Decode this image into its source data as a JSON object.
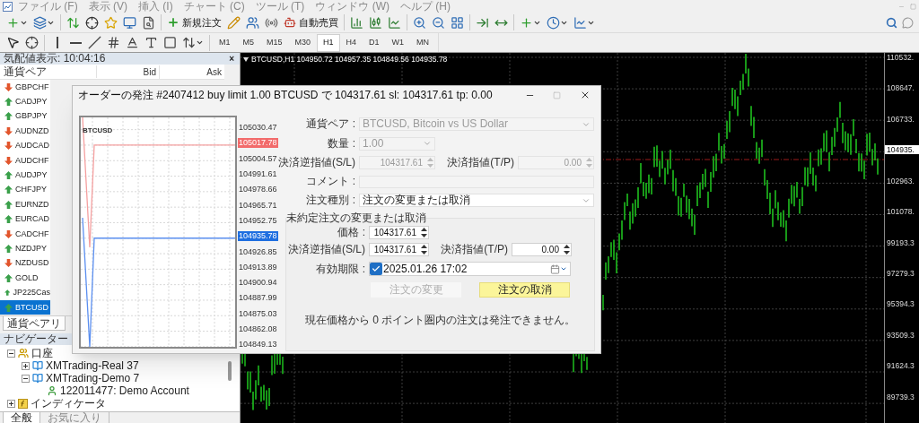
{
  "menu": [
    "ファイル (F)",
    "表示 (V)",
    "挿入 (I)",
    "チャート (C)",
    "ツール (T)",
    "ウィンドウ (W)",
    "ヘルプ (H)"
  ],
  "toolbar": {
    "new_order": "新規注文",
    "auto_trading": "自動売買"
  },
  "timeframes": [
    {
      "label": "M1",
      "selected": false
    },
    {
      "label": "M5",
      "selected": false
    },
    {
      "label": "M15",
      "selected": false
    },
    {
      "label": "M30",
      "selected": false
    },
    {
      "label": "H1",
      "selected": true
    },
    {
      "label": "H4",
      "selected": false
    },
    {
      "label": "D1",
      "selected": false
    },
    {
      "label": "W1",
      "selected": false
    },
    {
      "label": "MN",
      "selected": false
    }
  ],
  "market_watch": {
    "title": "気配値表示: 10:04:16",
    "close": "×",
    "columns": [
      "通貨ペア",
      "Bid",
      "Ask"
    ],
    "rows": [
      {
        "symbol": "GBPCHF",
        "rising": false,
        "selected": false
      },
      {
        "symbol": "CADJPY",
        "rising": true,
        "selected": false
      },
      {
        "symbol": "GBPJPY",
        "rising": true,
        "selected": false
      },
      {
        "symbol": "AUDNZD",
        "rising": false,
        "selected": false
      },
      {
        "symbol": "AUDCAD",
        "rising": false,
        "selected": false
      },
      {
        "symbol": "AUDCHF",
        "rising": false,
        "selected": false
      },
      {
        "symbol": "AUDJPY",
        "rising": true,
        "selected": false
      },
      {
        "symbol": "CHFJPY",
        "rising": true,
        "selected": false
      },
      {
        "symbol": "EURNZD",
        "rising": true,
        "selected": false
      },
      {
        "symbol": "EURCAD",
        "rising": true,
        "selected": false
      },
      {
        "symbol": "CADCHF",
        "rising": false,
        "selected": false
      },
      {
        "symbol": "NZDJPY",
        "rising": true,
        "selected": false
      },
      {
        "symbol": "NZDUSD",
        "rising": false,
        "selected": false
      },
      {
        "symbol": "GOLD",
        "rising": true,
        "selected": false
      },
      {
        "symbol": "JP225Cas",
        "rising": true,
        "selected": false
      },
      {
        "symbol": "BTCUSD",
        "rising": true,
        "selected": true
      }
    ],
    "tab": "通貨ペアリ"
  },
  "navigator": {
    "title": "ナビゲーター",
    "tree": [
      {
        "label": "口座",
        "kind": "accounts",
        "expanded": true,
        "children": [
          {
            "label": "XMTrading-Real 37",
            "kind": "server",
            "expanded": false
          },
          {
            "label": "XMTrading-Demo 7",
            "kind": "server",
            "expanded": true,
            "children": [
              {
                "label": "122011477: Demo Account",
                "kind": "account"
              }
            ]
          }
        ]
      },
      {
        "label": "インディケータ",
        "kind": "indicators",
        "expanded": false
      }
    ],
    "tabs": [
      {
        "label": "全般",
        "selected": true
      },
      {
        "label": "お気に入り",
        "selected": false
      }
    ]
  },
  "chart": {
    "header": "BTCUSD,H1 104950.72 104957.35 104849.56 104935.78",
    "price_axis": [
      {
        "label": "110532.",
        "kind": "tick"
      },
      {
        "label": "108647.",
        "kind": "tick"
      },
      {
        "label": "106733.",
        "kind": "tick"
      },
      {
        "label": "104935.",
        "kind": "current"
      },
      {
        "label": "102963.",
        "kind": "tick"
      },
      {
        "label": "101078.",
        "kind": "tick"
      },
      {
        "label": "99193.3",
        "kind": "tick"
      },
      {
        "label": "97279.3",
        "kind": "tick"
      },
      {
        "label": "95394.3",
        "kind": "tick"
      },
      {
        "label": "93509.3",
        "kind": "tick"
      },
      {
        "label": "91624.3",
        "kind": "tick"
      },
      {
        "label": "89739.3",
        "kind": "tick"
      }
    ]
  },
  "dialog": {
    "title": "オーダーの発注 #2407412 buy limit 1.00 BTCUSD で 104317.61 sl: 104317.61 tp: 0.00",
    "tick_chart": {
      "symbol": "BTCUSD",
      "axis": [
        {
          "label": "105030.47",
          "kind": "tick"
        },
        {
          "label": "105017.78",
          "kind": "ask"
        },
        {
          "label": "105004.57",
          "kind": "tick"
        },
        {
          "label": "104991.61",
          "kind": "tick"
        },
        {
          "label": "104978.66",
          "kind": "tick"
        },
        {
          "label": "104965.71",
          "kind": "tick"
        },
        {
          "label": "104952.75",
          "kind": "tick"
        },
        {
          "label": "104935.78",
          "kind": "bid"
        },
        {
          "label": "104926.85",
          "kind": "tick"
        },
        {
          "label": "104913.89",
          "kind": "tick"
        },
        {
          "label": "104900.94",
          "kind": "tick"
        },
        {
          "label": "104887.99",
          "kind": "tick"
        },
        {
          "label": "104875.03",
          "kind": "tick"
        },
        {
          "label": "104862.08",
          "kind": "tick"
        },
        {
          "label": "104849.13",
          "kind": "tick"
        }
      ]
    },
    "symbol": {
      "label": "通貨ペア :",
      "value": "BTCUSD, Bitcoin vs US Dollar",
      "disabled": true
    },
    "volume": {
      "label": "数量 :",
      "value": "1.00",
      "disabled": true
    },
    "stop_loss": {
      "label": "決済逆指値(S/L)",
      "value": "104317.61",
      "disabled": true
    },
    "take_profit": {
      "label": "決済指値(T/P)",
      "value": "0.00",
      "disabled": true
    },
    "comment": {
      "label": "コメント :",
      "disabled": true
    },
    "order_type": {
      "label": "注文種別 :",
      "value": "注文の変更または取消"
    },
    "modify": {
      "title": "未約定注文の変更または取消",
      "price": {
        "label": "価格 :",
        "value": "104317.61"
      },
      "stop_loss": {
        "label": "決済逆指値(S/L)",
        "value": "104317.61"
      },
      "take_profit": {
        "label": "決済指値(T/P)",
        "value": "0.00"
      },
      "expiry": {
        "label": "有効期限 :",
        "checked": true,
        "value": "2025.01.26 17:02"
      },
      "buttons": [
        {
          "label": "注文の変更",
          "kind": "modify",
          "disabled": true
        },
        {
          "label": "注文の取消",
          "kind": "cancel",
          "disabled": false
        }
      ],
      "message": "現在価格から 0 ポイント圏内の注文は発注できません。"
    }
  }
}
